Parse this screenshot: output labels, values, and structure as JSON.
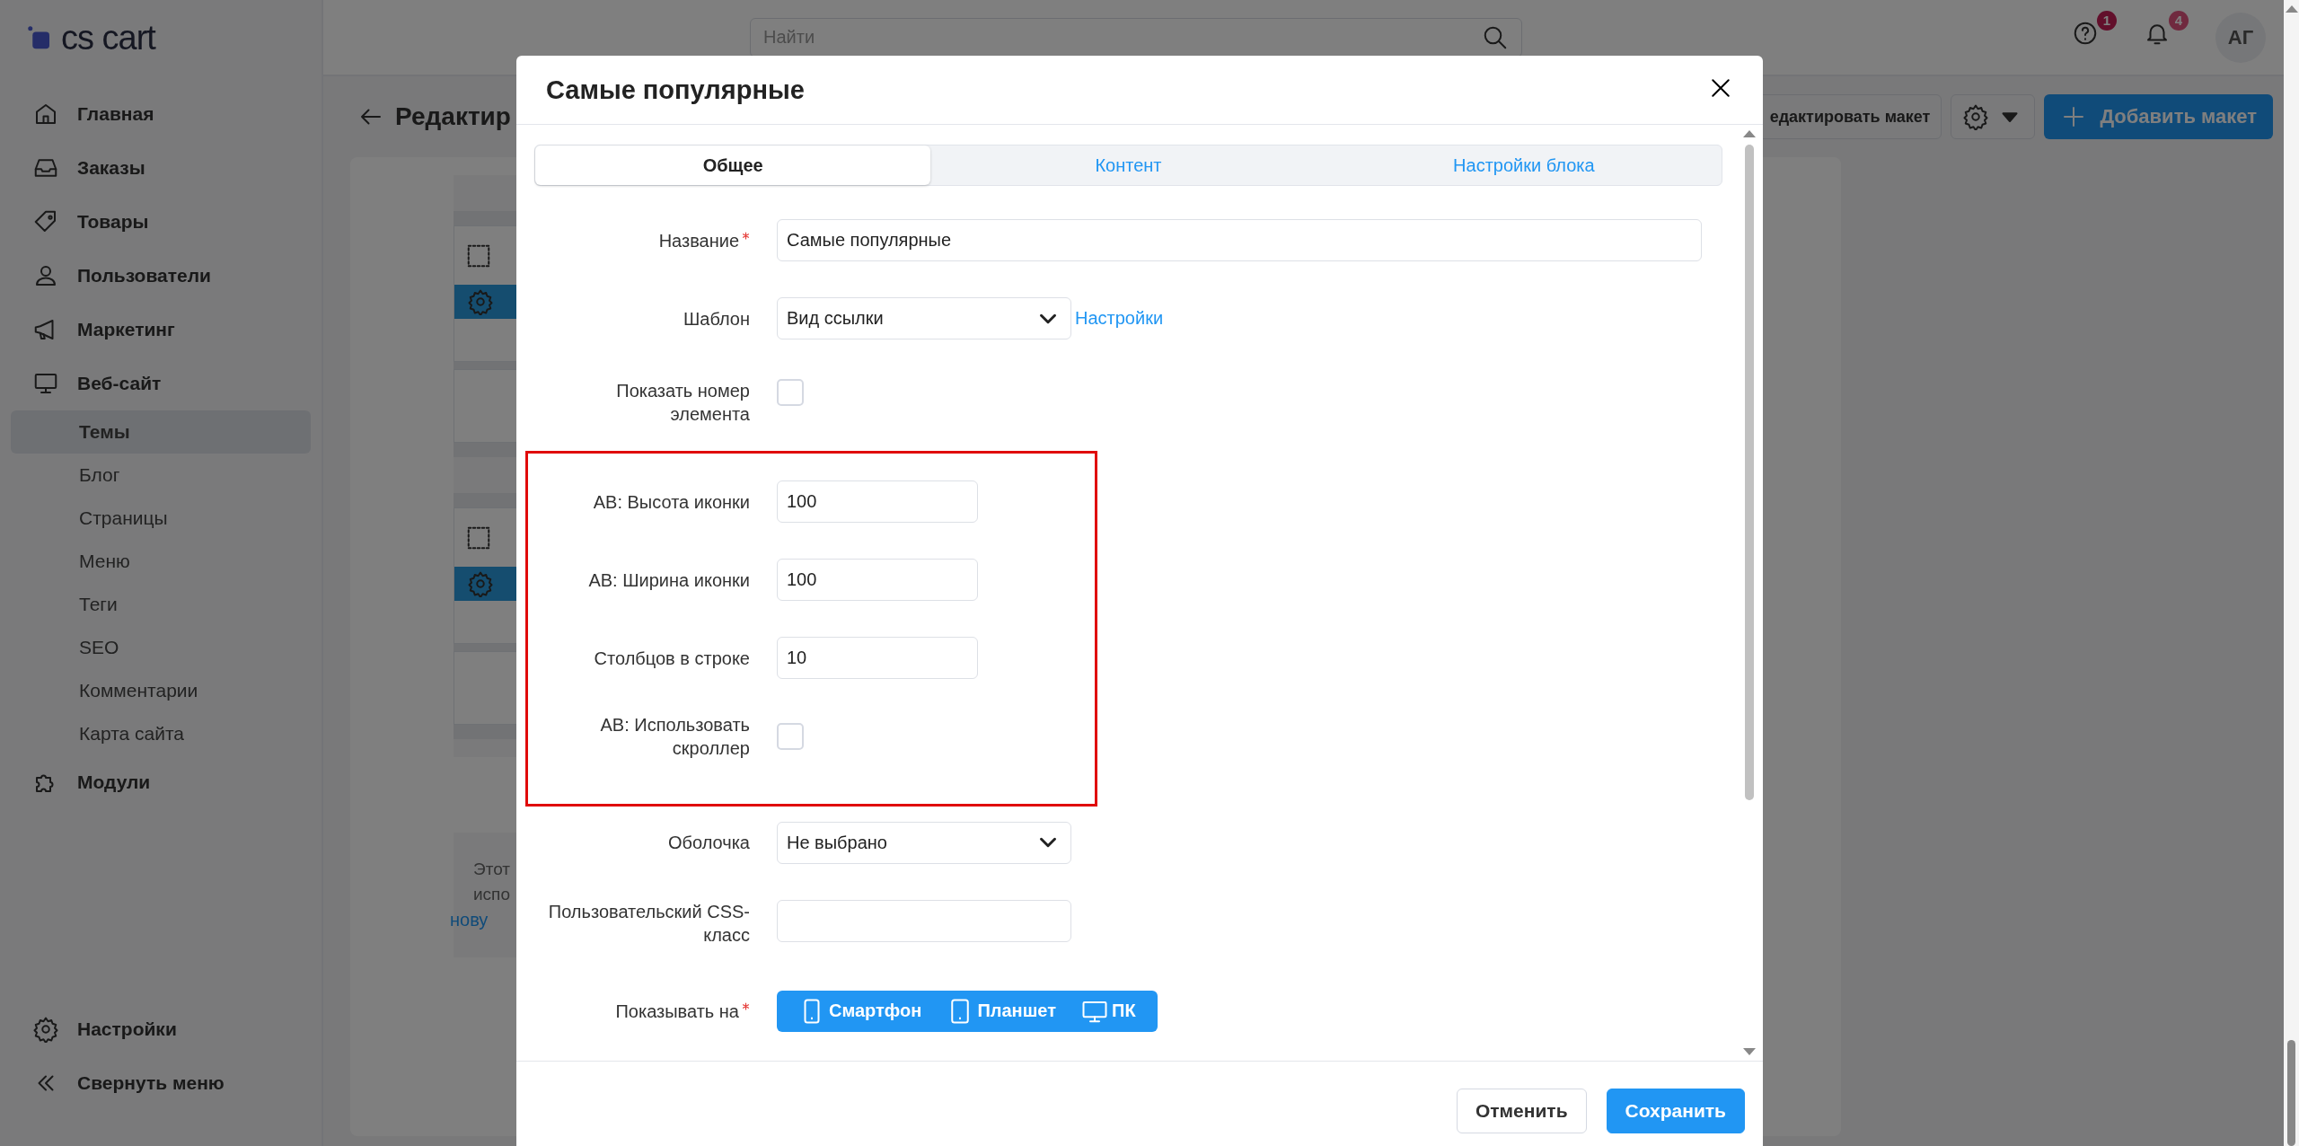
{
  "logo": {
    "text": "cs cart"
  },
  "sidebar": {
    "items": [
      {
        "label": "Главная",
        "selected": false
      },
      {
        "label": "Заказы",
        "selected": false
      },
      {
        "label": "Товары",
        "selected": false
      },
      {
        "label": "Пользователи",
        "selected": false
      },
      {
        "label": "Маркетинг",
        "selected": false
      },
      {
        "label": "Веб-сайт",
        "selected": false,
        "children": [
          {
            "label": "Темы",
            "selected": true
          },
          {
            "label": "Блог",
            "selected": false
          },
          {
            "label": "Страницы",
            "selected": false
          },
          {
            "label": "Меню",
            "selected": false
          },
          {
            "label": "Теги",
            "selected": false
          },
          {
            "label": "SEO",
            "selected": false
          },
          {
            "label": "Комментарии",
            "selected": false
          },
          {
            "label": "Карта сайта",
            "selected": false
          }
        ]
      },
      {
        "label": "Модули",
        "selected": false
      }
    ],
    "bottom_items": [
      {
        "label": "Настройки"
      },
      {
        "label": "Свернуть меню"
      }
    ]
  },
  "header": {
    "search": {
      "placeholder": "Найти"
    },
    "help_badge": "1",
    "notifications_badge": "4",
    "avatar": "АГ"
  },
  "page": {
    "title": "Редактир",
    "edit_layout_button": "едактировать макет",
    "add_layout_button": "Добавить макет",
    "note": [
      {
        "text": "Этот",
        "kind": "text"
      },
      {
        "text": "испо",
        "kind": "text"
      },
      {
        "text": "нову",
        "kind": "link"
      }
    ]
  },
  "modal": {
    "title": "Самые популярные",
    "tabs": [
      {
        "label": "Общее",
        "selected": true
      },
      {
        "label": "Контент",
        "selected": false
      },
      {
        "label": "Настройки блока",
        "selected": false
      }
    ],
    "fields_before": [
      {
        "kind": "wide_text",
        "label": "Название",
        "required": true,
        "value": "Самые популярные"
      },
      {
        "kind": "select",
        "label": "Шаблон",
        "required": false,
        "value": "Вид ссылки",
        "link": "Настройки"
      },
      {
        "kind": "checkbox",
        "label": "Показать номер элемента",
        "required": false,
        "checked": false
      }
    ],
    "highlighted_fields": [
      {
        "kind": "number",
        "label": "AB: Высота иконки",
        "required": false,
        "value": "100"
      },
      {
        "kind": "number",
        "label": "AB: Ширина иконки",
        "required": false,
        "value": "100"
      },
      {
        "kind": "number",
        "label": "Столбцов в строке",
        "required": false,
        "value": "10"
      },
      {
        "kind": "checkbox",
        "label": "AB: Использовать скроллер",
        "required": false,
        "checked": false
      }
    ],
    "fields_after": [
      {
        "kind": "select",
        "label": "Оболочка",
        "required": false,
        "value": "Не выбрано"
      },
      {
        "kind": "text",
        "label": "Пользовательский CSS-класс",
        "required": false
      },
      {
        "kind": "devices",
        "label": "Показывать на",
        "required": true,
        "options": [
          {
            "label": "Смартфон",
            "selected": true
          },
          {
            "label": "Планшет",
            "selected": true
          },
          {
            "label": "ПК",
            "selected": true
          }
        ]
      }
    ],
    "buttons": [
      {
        "label": "Отменить",
        "kind": "secondary"
      },
      {
        "label": "Сохранить",
        "kind": "primary"
      }
    ]
  }
}
